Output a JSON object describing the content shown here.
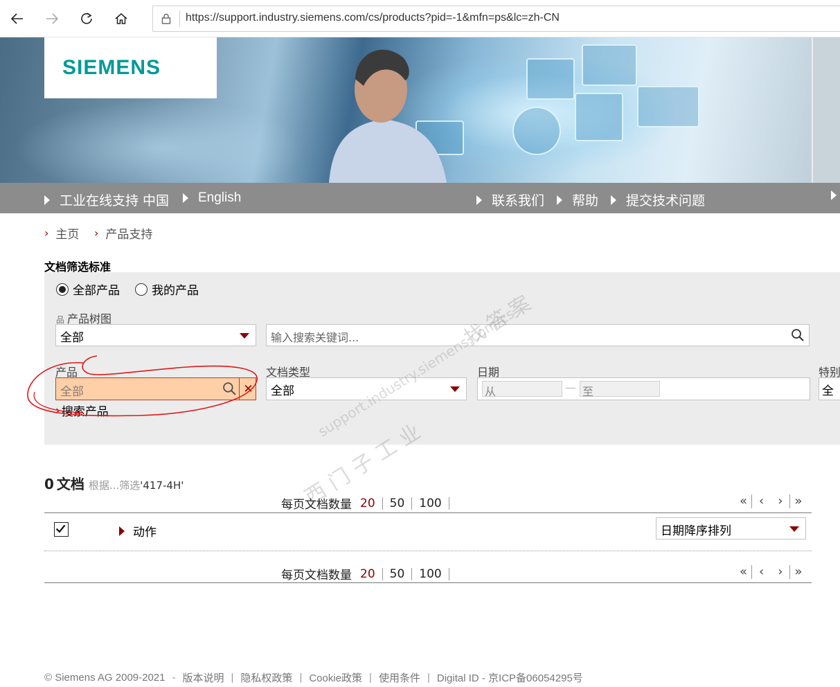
{
  "browser": {
    "url": "https://support.industry.siemens.com/cs/products?pid=-1&mfn=ps&lc=zh-CN"
  },
  "brand": {
    "logo": "SIEMENS",
    "logo_color": "#009999"
  },
  "topnav": {
    "left": [
      "工业在线支持 中国",
      "English"
    ],
    "right": [
      "联系我们",
      "帮助",
      "提交技术问题"
    ]
  },
  "breadcrumb": [
    "主页",
    "产品支持"
  ],
  "filter": {
    "title": "文档筛选标准",
    "scope_options": [
      "全部产品",
      "我的产品"
    ],
    "scope_selected": "全部产品",
    "tree_label": "产品树图",
    "tree_value": "全部",
    "search_placeholder": "输入搜索关键词...",
    "product_label": "产品",
    "product_value": "全部",
    "product_clear": "✕",
    "search_product_link": "搜索产品",
    "doc_type_label": "文档类型",
    "doc_type_value": "全部",
    "date_label": "日期",
    "date_from": "从",
    "date_dash": "—",
    "date_to": "至",
    "special_label": "特别",
    "special_value": "全部"
  },
  "watermark": {
    "line1": "西门子工业",
    "line2": "找答案",
    "line3": "support.industry.siemens.com/cs"
  },
  "results": {
    "count": "0",
    "word": "文档",
    "by": "根据...筛选",
    "query": "'417-4H'"
  },
  "pagination": {
    "label": "每页文档数量",
    "sizes": [
      "20",
      "50",
      "100"
    ],
    "active": "20",
    "first": "«",
    "prev": "‹",
    "next": "›",
    "last": "»"
  },
  "list": {
    "action_label": "动作",
    "sort_value": "日期降序排列"
  },
  "footer": {
    "copyright": "© Siemens AG 2009-2021",
    "links": [
      "版本说明",
      "隐私权政策",
      "Cookie政策",
      "使用条件",
      "Digital ID - 京ICP备06054295号"
    ]
  },
  "colors": {
    "accent": "#8c0000",
    "nav_bg": "#8c8c8c",
    "panel_bg": "#ececec",
    "highlight": "#ffd0a8"
  }
}
